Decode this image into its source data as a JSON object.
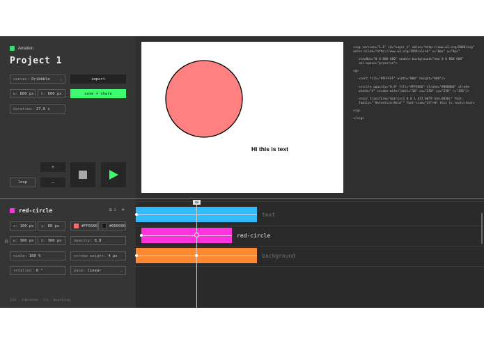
{
  "app": {
    "brand": "Amation",
    "project_title": "Project 1"
  },
  "controls": {
    "canvas_label": "canvas:",
    "canvas_value": "Dribbble",
    "import_label": "import",
    "width_label": "w:",
    "width_value": "800 px",
    "height_label": "h:",
    "height_value": "600 px",
    "save_label": "save + share",
    "duration_label": "duration:",
    "duration_value": "27.6 s",
    "plus": "+",
    "minus": "–",
    "loop_label": "loop"
  },
  "canvas": {
    "circle_fill": "#FF8080",
    "circle_stroke": "#000000",
    "text": "Hi this is text"
  },
  "code_lines": [
    "<svg version=\"1.1\" id=\"Layer_1\" xmlns=\"http://www.w3.org/2000/svg\" xmlns:xlink=\"http://www.w3.org/1999/xlink\" x=\"0px\" y=\"0px\"",
    "viewBox=\"0 0 800 600\" enable-background=\"new 0 0 800 600\" xml:space=\"preserve\">",
    "<g>",
    "<rect fill=\"#FFFFFF\" width=\"800\" height=\"600\"/>",
    "<circle opacity=\"0.8\" fill=\"#FF6666\" stroke=\"#000000\" stroke-width=\"4\" stroke-miterlimit=\"10\" cx=\"250\" cy=\"230\" r=\"150\"/>",
    "<text transform=\"matrix(1 0 0 1 437.0879 434.0938)\" font-family=\"'Helvetica-Bold'\" font-size=\"24\">Hi this is text</text>",
    "</g>",
    "</svg>"
  ],
  "layer": {
    "name": "red-circle",
    "color": "#ff33dd",
    "count": "2",
    "x_label": "x:",
    "x_value": "100 px",
    "y_label": "y:",
    "y_value": "80 px",
    "fill_value": "#FF6666",
    "stroke_value": "#000000",
    "w_label": "w:",
    "w_value": "300 px",
    "h_label": "h:",
    "h_value": "300 px",
    "opacity_label": "opacity:",
    "opacity_value": "0.8",
    "scale_label": "scale:",
    "scale_value": "100 %",
    "stroke_weight_label": "stroke weight:",
    "stroke_weight_value": "4 px",
    "rotation_label": "rotation:",
    "rotation_value": "0 °",
    "ease_label": "ease:",
    "ease_value": "linear"
  },
  "timeline": {
    "playhead_label": "00",
    "tracks": [
      {
        "label": "text",
        "color": "#33bbff"
      },
      {
        "label": "red-circle",
        "color": "#ff33dd"
      },
      {
        "label": "background",
        "color": "#ff8833"
      }
    ]
  },
  "footer": "jkil · ethernetbe · t/n · bousfecing"
}
